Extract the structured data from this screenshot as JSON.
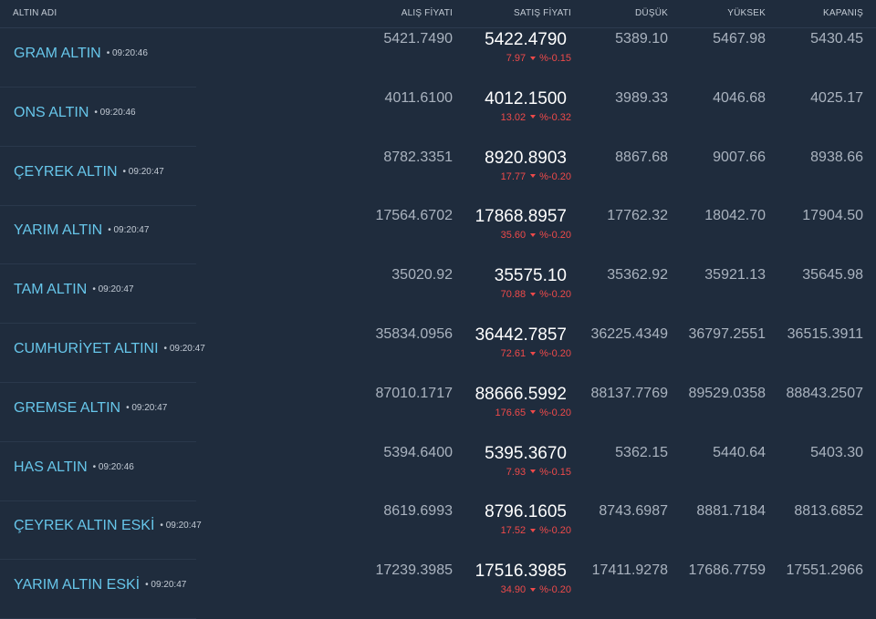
{
  "header": {
    "name": "ALTIN ADI",
    "alis": "ALIŞ FİYATI",
    "satis": "SATIŞ FİYATI",
    "dusuk": "DÜŞÜK",
    "yuksek": "YÜKSEK",
    "kapanis": "KAPANIŞ"
  },
  "colors": {
    "background": "#1f2c3d",
    "name": "#67c6ea",
    "price": "#ffffff",
    "negative": "#ee4a4a",
    "muted": "#aab3bf"
  },
  "icons": {
    "change_direction": "caret-down-icon"
  },
  "rows": [
    {
      "name": "GRAM ALTIN",
      "time": "• 09:20:46",
      "alis": "5421.7490",
      "satis": "5422.4790",
      "change": "7.97",
      "change_pct": "%-0.15",
      "dusuk": "5389.10",
      "yuksek": "5467.98",
      "kapanis": "5430.45"
    },
    {
      "name": "ONS ALTIN",
      "time": "• 09:20:46",
      "alis": "4011.6100",
      "satis": "4012.1500",
      "change": "13.02",
      "change_pct": "%-0.32",
      "dusuk": "3989.33",
      "yuksek": "4046.68",
      "kapanis": "4025.17"
    },
    {
      "name": "ÇEYREK ALTIN",
      "time": "• 09:20:47",
      "alis": "8782.3351",
      "satis": "8920.8903",
      "change": "17.77",
      "change_pct": "%-0.20",
      "dusuk": "8867.68",
      "yuksek": "9007.66",
      "kapanis": "8938.66"
    },
    {
      "name": "YARIM ALTIN",
      "time": "• 09:20:47",
      "alis": "17564.6702",
      "satis": "17868.8957",
      "change": "35.60",
      "change_pct": "%-0.20",
      "dusuk": "17762.32",
      "yuksek": "18042.70",
      "kapanis": "17904.50"
    },
    {
      "name": "TAM ALTIN",
      "time": "• 09:20:47",
      "alis": "35020.92",
      "satis": "35575.10",
      "change": "70.88",
      "change_pct": "%-0.20",
      "dusuk": "35362.92",
      "yuksek": "35921.13",
      "kapanis": "35645.98"
    },
    {
      "name": "CUMHURİYET ALTINI",
      "time": "• 09:20:47",
      "alis": "35834.0956",
      "satis": "36442.7857",
      "change": "72.61",
      "change_pct": "%-0.20",
      "dusuk": "36225.4349",
      "yuksek": "36797.2551",
      "kapanis": "36515.3911"
    },
    {
      "name": "GREMSE ALTIN",
      "time": "• 09:20:47",
      "alis": "87010.1717",
      "satis": "88666.5992",
      "change": "176.65",
      "change_pct": "%-0.20",
      "dusuk": "88137.7769",
      "yuksek": "89529.0358",
      "kapanis": "88843.2507"
    },
    {
      "name": "HAS ALTIN",
      "time": "• 09:20:46",
      "alis": "5394.6400",
      "satis": "5395.3670",
      "change": "7.93",
      "change_pct": "%-0.15",
      "dusuk": "5362.15",
      "yuksek": "5440.64",
      "kapanis": "5403.30"
    },
    {
      "name": "ÇEYREK ALTIN ESKİ",
      "time": "• 09:20:47",
      "alis": "8619.6993",
      "satis": "8796.1605",
      "change": "17.52",
      "change_pct": "%-0.20",
      "dusuk": "8743.6987",
      "yuksek": "8881.7184",
      "kapanis": "8813.6852"
    },
    {
      "name": "YARIM ALTIN ESKİ",
      "time": "• 09:20:47",
      "alis": "17239.3985",
      "satis": "17516.3985",
      "change": "34.90",
      "change_pct": "%-0.20",
      "dusuk": "17411.9278",
      "yuksek": "17686.7759",
      "kapanis": "17551.2966"
    }
  ]
}
